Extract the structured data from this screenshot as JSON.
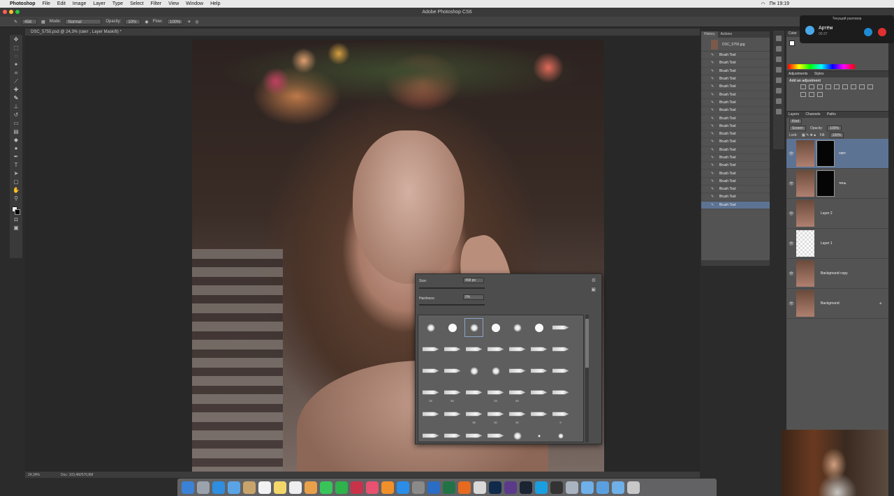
{
  "menubar": {
    "app_name": "Photoshop",
    "menus": [
      "File",
      "Edit",
      "Image",
      "Layer",
      "Type",
      "Select",
      "Filter",
      "View",
      "Window",
      "Help"
    ],
    "clock": "Пн 19:19"
  },
  "window": {
    "title": "Adobe Photoshop CS6"
  },
  "options_bar": {
    "mode_label": "Mode:",
    "mode_value": "Normal",
    "opacity_label": "Opacity:",
    "opacity_value": "10%",
    "flow_label": "Flow:",
    "flow_value": "100%",
    "brush_size": "458"
  },
  "document": {
    "tab_title": "DSC_5755.psd @ 24,3% (свет , Layer Mask/8) *",
    "zoom": "24,34%",
    "doc_size": "Doc: 103,4M/570,8M"
  },
  "brush_picker": {
    "size_label": "Size:",
    "size_value": "458 px",
    "hardness_label": "Hardness:",
    "hardness_value": "0%",
    "brush_numbers": [
      "25",
      "50",
      "25",
      "50",
      "36",
      "30",
      "30",
      "9"
    ]
  },
  "history": {
    "tabs": [
      "History",
      "Actions"
    ],
    "snapshot": "DSC_5755.jpg",
    "items": [
      "Brush Tool",
      "Brush Tool",
      "Brush Tool",
      "Brush Tool",
      "Brush Tool",
      "Brush Tool",
      "Brush Tool",
      "Brush Tool",
      "Brush Tool",
      "Brush Tool",
      "Brush Tool",
      "Brush Tool",
      "Brush Tool",
      "Brush Tool",
      "Brush Tool",
      "Brush Tool",
      "Brush Tool",
      "Brush Tool",
      "Brush Tool",
      "Brush Tool"
    ]
  },
  "color_panel": {
    "tab": "Color"
  },
  "adjustments_panel": {
    "tabs": [
      "Adjustments",
      "Styles"
    ],
    "title": "Add an adjustment"
  },
  "layers_panel": {
    "tabs": [
      "Layers",
      "Channels",
      "Paths"
    ],
    "kind": "Kind",
    "blend_mode": "Screen",
    "opacity_label": "Opacity:",
    "opacity_value": "100%",
    "lock_label": "Lock:",
    "fill_label": "Fill:",
    "fill_value": "100%",
    "layers": [
      {
        "name": "свет",
        "selected": true,
        "mask": true
      },
      {
        "name": "тень",
        "selected": false,
        "mask": true
      },
      {
        "name": "Layer 2",
        "selected": false,
        "mask": false
      },
      {
        "name": "Layer 1",
        "selected": false,
        "mask": false
      },
      {
        "name": "Background copy",
        "selected": false,
        "mask": false
      },
      {
        "name": "Background",
        "selected": false,
        "mask": false
      }
    ]
  },
  "call": {
    "header": "Текущий разговор",
    "caller": "Артём",
    "duration": "00:37"
  }
}
